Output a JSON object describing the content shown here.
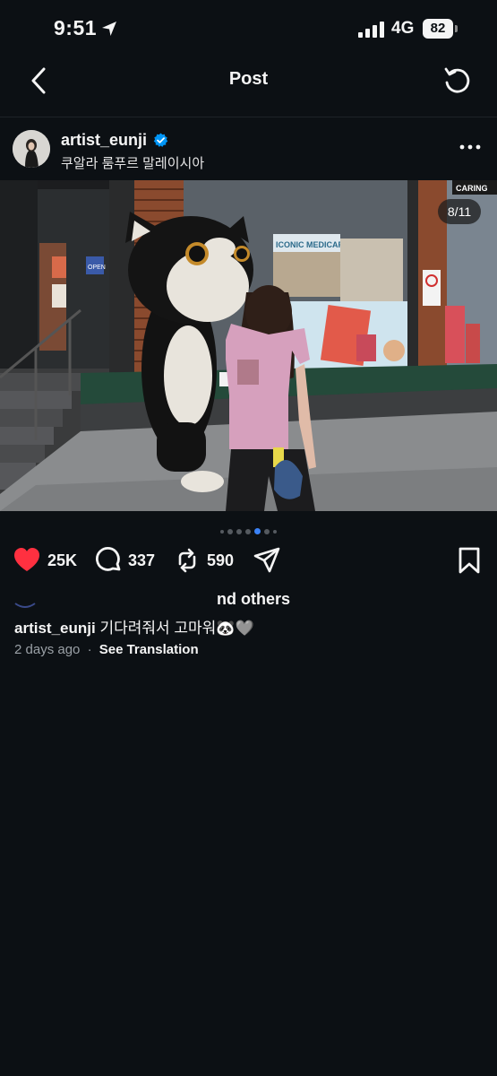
{
  "status_bar": {
    "time": "9:51",
    "network": "4G",
    "battery": "82"
  },
  "nav": {
    "title": "Post"
  },
  "post": {
    "username": "artist_eunji",
    "location": "쿠알라 룸푸르 말레이시아",
    "photo_counter": "8/11",
    "photo_signs": {
      "store": "ICONIC MEDICARE",
      "brand": "CARING",
      "open": "OPEN"
    },
    "carousel": {
      "count": 7,
      "active_index": 4
    },
    "likes": "25K",
    "comments": "337",
    "reposts": "590",
    "liked_by": "nd others",
    "caption_user": "artist_eunji",
    "caption_text": "기다려줘서 고마워🐼🩶",
    "time_ago": "2 days ago",
    "separator": "·",
    "see_translation": "See Translation"
  },
  "colors": {
    "background": "#0c1014",
    "like_red": "#ff3040",
    "active_dot": "#3b82f6",
    "verified": "#0095f6"
  },
  "icons": [
    "location-arrow-icon",
    "signal-icon",
    "battery-icon",
    "back-icon",
    "refresh-icon",
    "verified-icon",
    "more-icon",
    "heart-icon",
    "comment-icon",
    "repost-icon",
    "share-icon",
    "bookmark-icon"
  ]
}
